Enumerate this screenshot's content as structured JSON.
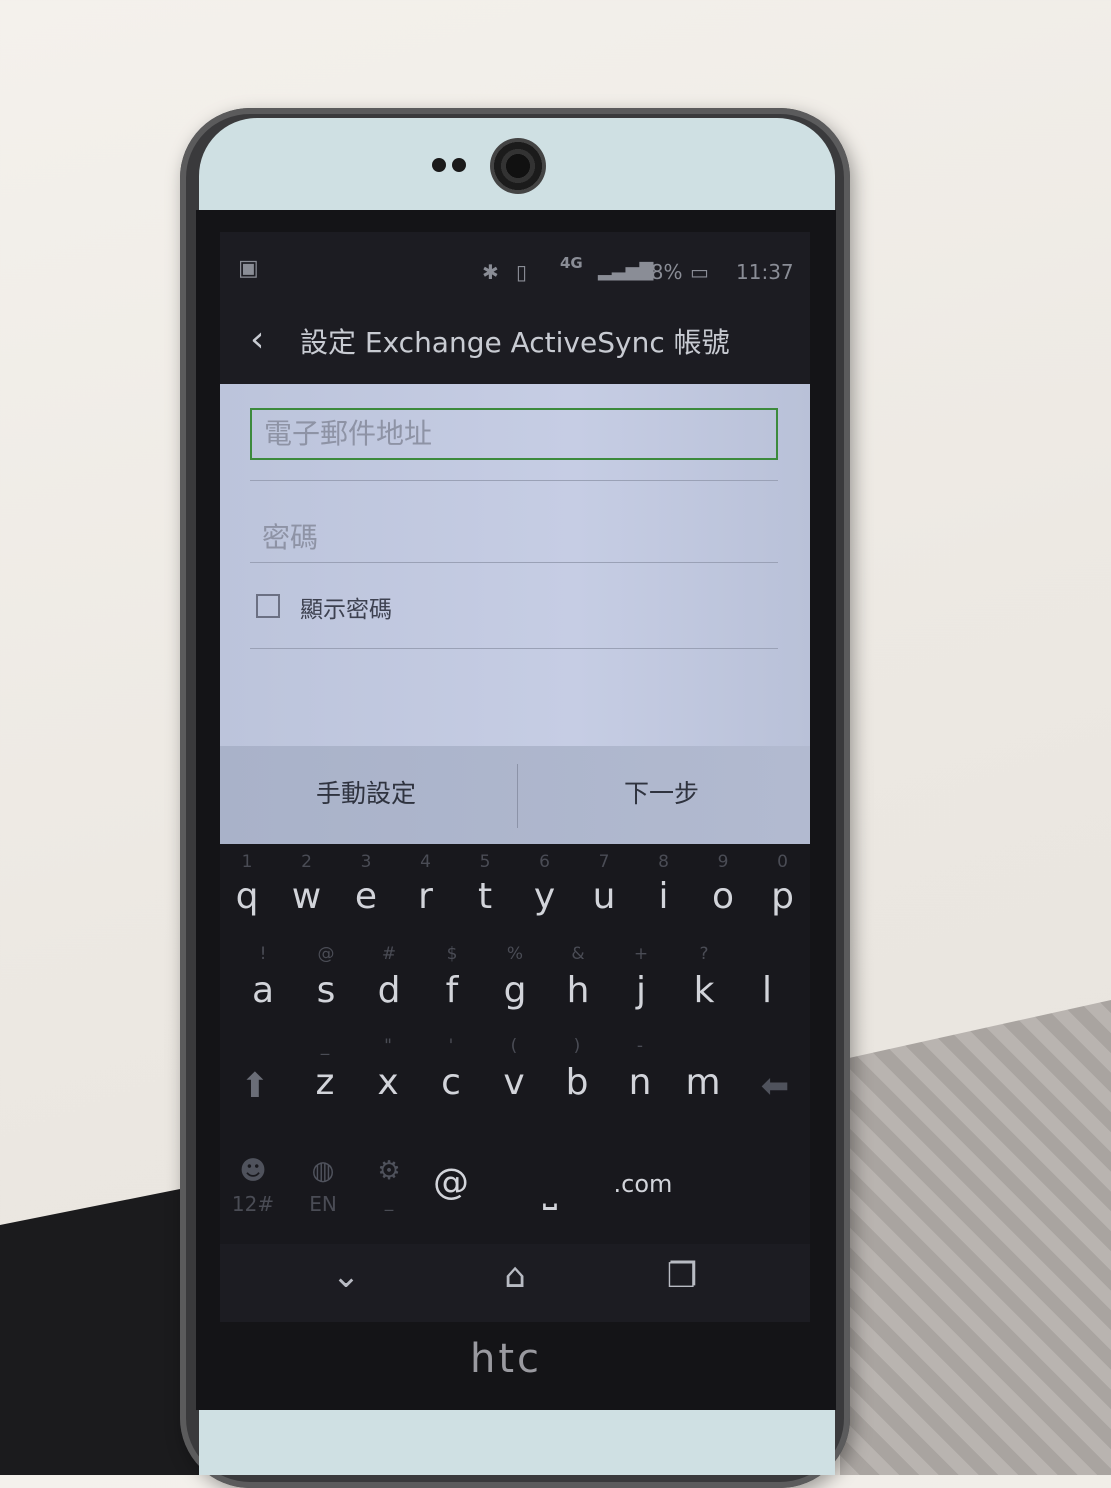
{
  "status_bar": {
    "bluetooth_icon": "bluetooth-icon",
    "vibrate_icon": "vibrate-icon",
    "network": "4G",
    "signal_icon": "signal-icon",
    "battery_percent": "78%",
    "battery_icon": "battery-icon",
    "time": "11:37"
  },
  "app_bar": {
    "back_icon": "back-arrow-icon",
    "title": "設定 Exchange ActiveSync 帳號"
  },
  "form": {
    "email_placeholder": "電子郵件地址",
    "password_placeholder": "密碼",
    "show_password_label": "顯示密碼",
    "show_password_checked": false
  },
  "buttons": {
    "manual_setup": "手動設定",
    "next": "下一步"
  },
  "keyboard": {
    "row1": [
      "q",
      "w",
      "e",
      "r",
      "t",
      "y",
      "u",
      "i",
      "o",
      "p"
    ],
    "row1_hints": [
      "1",
      "2",
      "3",
      "4",
      "5",
      "6",
      "7",
      "8",
      "9",
      "0"
    ],
    "row2": [
      "a",
      "s",
      "d",
      "f",
      "g",
      "h",
      "j",
      "k",
      "l"
    ],
    "row2_hints": [
      "!",
      "@",
      "#",
      "$",
      "%",
      "&",
      "+",
      "?",
      ""
    ],
    "row3": [
      "z",
      "x",
      "c",
      "v",
      "b",
      "n",
      "m"
    ],
    "row3_hints": [
      "_",
      "\"",
      "'",
      "(",
      ")",
      "-",
      ""
    ],
    "shift_icon": "shift-arrow-icon",
    "backspace_icon": "backspace-icon",
    "emoji_icon": "emoji-icon",
    "emoji_hint": "12#",
    "globe_icon": "globe-icon",
    "globe_hint": "EN",
    "settings_icon": "gear-icon",
    "settings_hint": "_",
    "at_key": "@",
    "space_icon": "space-bar-icon",
    "dotcom_key": ".com"
  },
  "nav_bar": {
    "back_icon": "chevron-down-icon",
    "home_icon": "home-icon",
    "recents_icon": "recents-icon"
  },
  "device": {
    "brand": "htc"
  }
}
